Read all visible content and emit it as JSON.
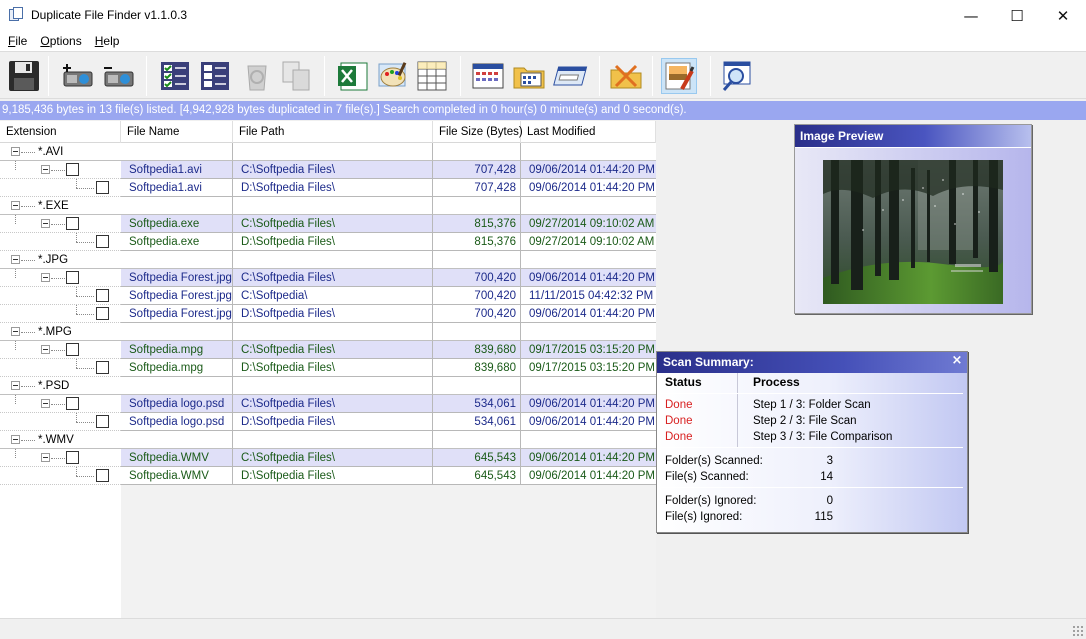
{
  "window": {
    "title": "Duplicate File Finder v1.1.0.3",
    "controls": {
      "minimize": "—",
      "maximize": "☐",
      "close": "✕"
    }
  },
  "menu": [
    {
      "label": "File",
      "mnemonic": "F"
    },
    {
      "label": "Options",
      "mnemonic": "O"
    },
    {
      "label": "Help",
      "mnemonic": "H"
    }
  ],
  "toolbar": {
    "buttons": [
      {
        "id": "save",
        "icon": "floppy-disk-icon"
      },
      {
        "id": "add-folder",
        "icon": "add-drive-icon"
      },
      {
        "id": "remove-folder",
        "icon": "remove-drive-icon"
      },
      {
        "id": "check-all",
        "icon": "checklist-icon"
      },
      {
        "id": "uncheck-all",
        "icon": "unchecklist-icon"
      },
      {
        "id": "recycle",
        "icon": "recycle-bin-icon"
      },
      {
        "id": "copy-move",
        "icon": "copy-files-icon"
      },
      {
        "id": "export-excel",
        "icon": "excel-icon"
      },
      {
        "id": "customize",
        "icon": "paint-palette-icon"
      },
      {
        "id": "columns",
        "icon": "table-grid-icon"
      },
      {
        "id": "calendar",
        "icon": "calendar-window-icon"
      },
      {
        "id": "open-folder",
        "icon": "folder-calendar-icon"
      },
      {
        "id": "rename",
        "icon": "rename-window-icon"
      },
      {
        "id": "clear",
        "icon": "eraser-folder-icon"
      },
      {
        "id": "preview",
        "icon": "image-preview-icon",
        "active": true
      },
      {
        "id": "search",
        "icon": "magnifier-window-icon"
      }
    ]
  },
  "status_line": "9,185,436 bytes in 13 file(s) listed. [4,942,928 bytes duplicated in 7 file(s).] Search completed in 0 hour(s) 0 minute(s) and 0 second(s).",
  "grid": {
    "columns": [
      "Extension",
      "File Name",
      "File Path",
      "File Size (Bytes)",
      "Last Modified"
    ],
    "groups": [
      {
        "ext": "*.AVI",
        "color": "blue",
        "files": [
          {
            "name": "Softpedia1.avi",
            "path": "C:\\Softpedia Files\\",
            "size": "707,428",
            "date": "09/06/2014 01:44:20 PM"
          },
          {
            "name": "Softpedia1.avi",
            "path": "D:\\Softpedia Files\\",
            "size": "707,428",
            "date": "09/06/2014 01:44:20 PM"
          }
        ]
      },
      {
        "ext": "*.EXE",
        "color": "green",
        "files": [
          {
            "name": "Softpedia.exe",
            "path": "C:\\Softpedia Files\\",
            "size": "815,376",
            "date": "09/27/2014 09:10:02 AM"
          },
          {
            "name": "Softpedia.exe",
            "path": "D:\\Softpedia Files\\",
            "size": "815,376",
            "date": "09/27/2014 09:10:02 AM"
          }
        ]
      },
      {
        "ext": "*.JPG",
        "color": "blue",
        "files": [
          {
            "name": "Softpedia Forest.jpg",
            "path": "C:\\Softpedia Files\\",
            "size": "700,420",
            "date": "09/06/2014 01:44:20 PM"
          },
          {
            "name": "Softpedia Forest.jpg",
            "path": "C:\\Softpedia\\",
            "size": "700,420",
            "date": "11/11/2015 04:42:32 PM"
          },
          {
            "name": "Softpedia Forest.jpg",
            "path": "D:\\Softpedia Files\\",
            "size": "700,420",
            "date": "09/06/2014 01:44:20 PM"
          }
        ]
      },
      {
        "ext": "*.MPG",
        "color": "green",
        "files": [
          {
            "name": "Softpedia.mpg",
            "path": "C:\\Softpedia Files\\",
            "size": "839,680",
            "date": "09/17/2015 03:15:20 PM"
          },
          {
            "name": "Softpedia.mpg",
            "path": "D:\\Softpedia Files\\",
            "size": "839,680",
            "date": "09/17/2015 03:15:20 PM"
          }
        ]
      },
      {
        "ext": "*.PSD",
        "color": "blue",
        "files": [
          {
            "name": "Softpedia logo.psd",
            "path": "C:\\Softpedia Files\\",
            "size": "534,061",
            "date": "09/06/2014 01:44:20 PM"
          },
          {
            "name": "Softpedia logo.psd",
            "path": "D:\\Softpedia Files\\",
            "size": "534,061",
            "date": "09/06/2014 01:44:20 PM"
          }
        ]
      },
      {
        "ext": "*.WMV",
        "color": "green",
        "files": [
          {
            "name": "Softpedia.WMV",
            "path": "C:\\Softpedia Files\\",
            "size": "645,543",
            "date": "09/06/2014 01:44:20 PM"
          },
          {
            "name": "Softpedia.WMV",
            "path": "D:\\Softpedia Files\\",
            "size": "645,543",
            "date": "09/06/2014 01:44:20 PM"
          }
        ]
      }
    ]
  },
  "preview": {
    "title": "Image Preview",
    "image": "forest-photo"
  },
  "scan_summary": {
    "title": "Scan Summary:",
    "close": "×",
    "status_header": "Status",
    "process_header": "Process",
    "steps": [
      {
        "status": "Done",
        "process": "Step 1 / 3: Folder Scan"
      },
      {
        "status": "Done",
        "process": "Step 2 / 3: File Scan"
      },
      {
        "status": "Done",
        "process": "Step 3 / 3: File Comparison"
      }
    ],
    "folders_scanned_label": "Folder(s) Scanned:",
    "folders_scanned": "3",
    "files_scanned_label": "File(s) Scanned:",
    "files_scanned": "14",
    "folders_ignored_label": "Folder(s) Ignored:",
    "folders_ignored": "0",
    "files_ignored_label": "File(s) Ignored:",
    "files_ignored": "115"
  },
  "colors": {
    "status_bar": "#9aa7f0",
    "highlight_row": "#e0e0f8",
    "text_blue": "#1c2a8a",
    "text_green": "#1a5a18",
    "status_done": "#d82020",
    "panel_title": "#2a2f8a"
  }
}
